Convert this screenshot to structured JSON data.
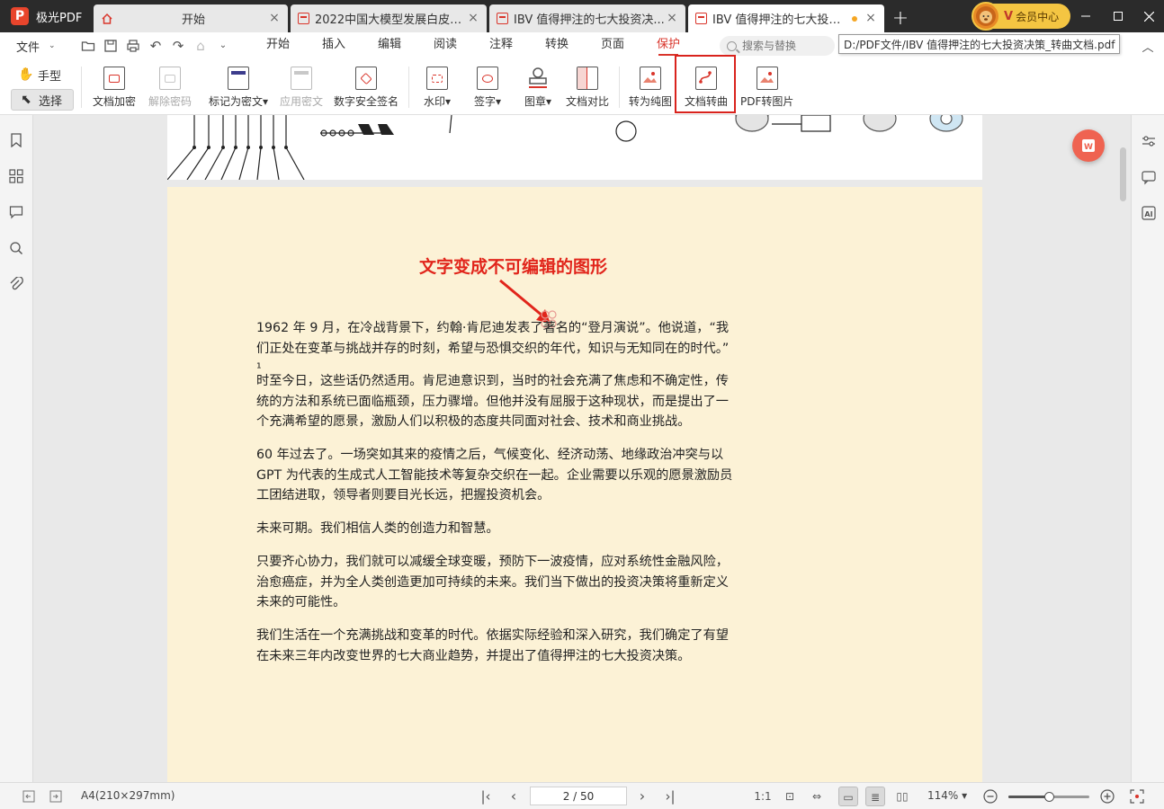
{
  "app": {
    "name": "极光PDF",
    "logo_letter": "P"
  },
  "tabs": [
    {
      "label": "开始",
      "type": "home"
    },
    {
      "label": "2022中国大模型发展白皮书...",
      "type": "pdf"
    },
    {
      "label": "IBV 值得押注的七大投资决...",
      "type": "pdf"
    },
    {
      "label": "IBV 值得押注的七大投资决...",
      "type": "pdf",
      "active": true,
      "unsaved": true
    }
  ],
  "vip": {
    "badge": "V",
    "label": "会员中心"
  },
  "file_menu": "文件",
  "menu_tabs": [
    "开始",
    "插入",
    "编辑",
    "阅读",
    "注释",
    "转换",
    "页面",
    "保护"
  ],
  "active_menu": "保护",
  "search": {
    "placeholder": "搜索与替换"
  },
  "tooltip": "D:/PDF文件/IBV 值得押注的七大投资决策_转曲文档.pdf",
  "modes": {
    "hand": "手型",
    "select": "选择"
  },
  "ribbon": {
    "encrypt": "文档加密",
    "decrypt": "解除密码",
    "mark_redact": "标记为密文",
    "apply_redact": "应用密文",
    "digital_sign": "数字安全签名",
    "watermark": "水印",
    "signature": "签字",
    "stamp": "图章",
    "compare": "文档对比",
    "to_image_pdf": "转为纯图",
    "outline_text": "文档转曲",
    "pdf_to_image": "PDF转图片"
  },
  "document": {
    "annotation": "文字变成不可编辑的图形",
    "paragraphs": [
      "1962 年 9 月，在冷战背景下，约翰·肯尼迪发表了著名的“登月演说”。他说道，“我们正处在变革与挑战并存的时刻，希望与恐惧交织的年代，知识与无知同在的时代。” ¹",
      "时至今日，这些话仍然适用。肯尼迪意识到，当时的社会充满了焦虑和不确定性，传统的方法和系统已面临瓶颈，压力骤增。但他并没有屈服于这种现状，而是提出了一个充满希望的愿景，激励人们以积极的态度共同面对社会、技术和商业挑战。",
      "60 年过去了。一场突如其来的疫情之后，气候变化、经济动荡、地缘政治冲突与以 GPT 为代表的生成式人工智能技术等复杂交织在一起。企业需要以乐观的愿景激励员工团结进取，领导者则要目光长远，把握投资机会。",
      "未来可期。我们相信人类的创造力和智慧。",
      "只要齐心协力，我们就可以减缓全球变暖，预防下一波疫情，应对系统性金融风险，治愈癌症，并为全人类创造更加可持续的未来。我们当下做出的投资决策将重新定义未来的可能性。",
      "我们生活在一个充满挑战和变革的时代。依据实际经验和深入研究，我们确定了有望在未来三年内改变世界的七大商业趋势，并提出了值得押注的七大投资决策。"
    ]
  },
  "status": {
    "page_size": "A4(210×297mm)",
    "page_indicator": "2 / 50",
    "zoom": "114%",
    "zoom_fraction": 0.5
  },
  "colors": {
    "accent": "#d9352b",
    "page_bg": "#fcf2d6",
    "titlebar": "#2b2b2b"
  }
}
